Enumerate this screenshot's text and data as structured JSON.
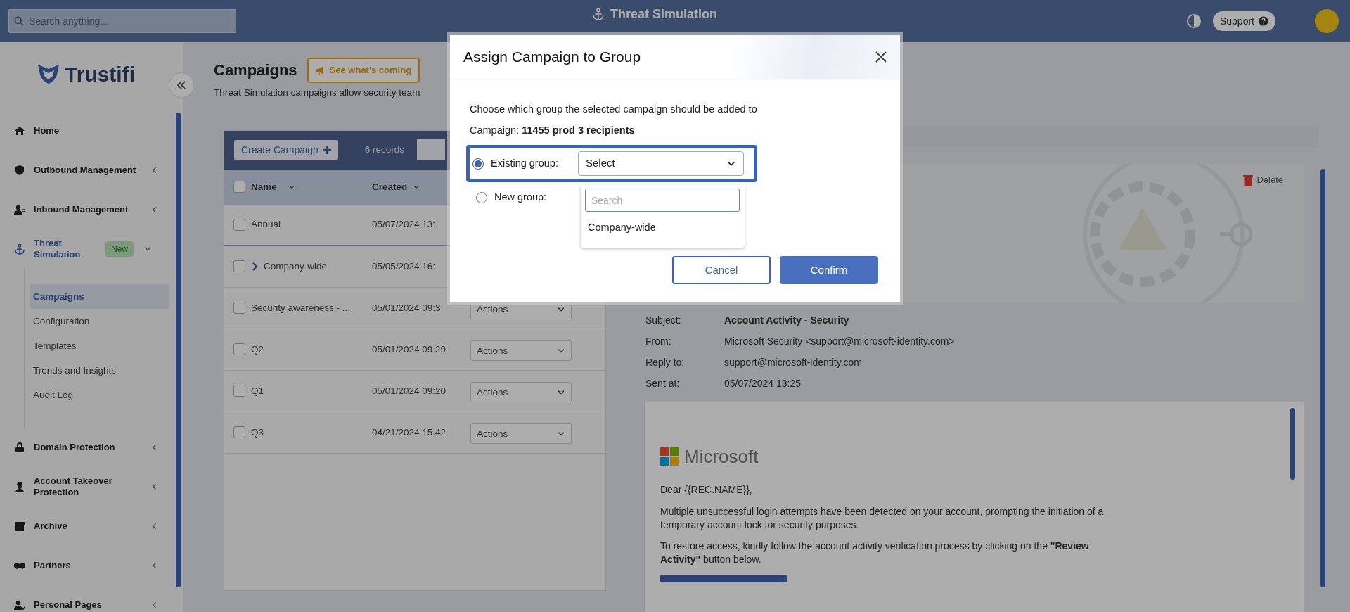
{
  "top_bar": {
    "search": {
      "placeholder": "Search anything..."
    },
    "title": "Threat Simulation",
    "support": "Support"
  },
  "sidebar": {
    "logo": "Trustifi",
    "items": [
      {
        "label": "Home"
      },
      {
        "label": "Outbound Management",
        "expanded": false
      },
      {
        "label": "Inbound Management",
        "expanded": false
      },
      {
        "label": "Threat Simulation",
        "expanded": true,
        "selected": true,
        "badge": "New",
        "children": [
          {
            "label": "Campaigns",
            "selected": true
          },
          {
            "label": "Configuration",
            "selected": false
          },
          {
            "label": "Templates",
            "selected": false
          },
          {
            "label": "Trends and Insights",
            "selected": false
          },
          {
            "label": "Audit Log",
            "selected": false
          }
        ]
      },
      {
        "label": "Domain Protection",
        "expanded": false
      },
      {
        "label": "Account Takeover Protection",
        "expanded": false
      },
      {
        "label": "Archive",
        "expanded": false
      },
      {
        "label": "Partners",
        "expanded": false
      },
      {
        "label": "Personal Pages",
        "expanded": false
      }
    ]
  },
  "page": {
    "title": "Campaigns",
    "whats_coming": "See what's coming",
    "description": "Threat Simulation campaigns allow security team"
  },
  "table": {
    "create_button": "Create Campaign",
    "records": "6 records",
    "select_all": {
      "checked": false
    },
    "columns": [
      "Name",
      "Created"
    ],
    "rows": [
      {
        "checked": false,
        "name": "Annual",
        "created": "05/07/2024 13:"
      },
      {
        "checked": false,
        "name": "Company-wide",
        "created": "05/05/2024 16:",
        "expanded": false
      },
      {
        "checked": false,
        "name": "Security awareness - ...",
        "created": "05/01/2024 09:3",
        "action": "Actions"
      },
      {
        "checked": false,
        "name": "Q2",
        "created": "05/01/2024 09:29",
        "action": "Actions"
      },
      {
        "checked": false,
        "name": "Q1",
        "created": "05/01/2024 09:20",
        "action": "Actions"
      },
      {
        "checked": false,
        "name": "Q3",
        "created": "04/21/2024 15:42",
        "action": "Actions"
      }
    ]
  },
  "details": {
    "delete": "Delete",
    "fields": [
      {
        "label": "Subject:",
        "value": "Account Activity - Security"
      },
      {
        "label": "From:",
        "value": "Microsoft Security <support@microsoft-identity.com>"
      },
      {
        "label": "Reply to:",
        "value": "support@microsoft-identity.com"
      },
      {
        "label": "Sent at:",
        "value": "05/07/2024 13:25"
      }
    ],
    "email": {
      "brand": "Microsoft",
      "greeting": "Dear {{REC.NAME}},",
      "paragraphs": [
        "Multiple unsuccessful login attempts have been detected on your account, prompting the initiation of a temporary account lock for security purposes.",
        "To restore access, kindly follow the account activity verification process by clicking on the **\"Review Activity\"** button below."
      ]
    }
  },
  "dialog": {
    "title": "Assign Campaign to Group",
    "description": "Choose which group the selected campaign should be added to",
    "campaign": "Campaign: **11455 prod 3 recipients**",
    "options": [
      {
        "label": "Existing group:",
        "selected": true
      },
      {
        "label": "New group:",
        "selected": false
      }
    ],
    "select": {
      "value": "Select",
      "open": true,
      "search_placeholder": "Search",
      "options": [
        "Company-wide"
      ]
    },
    "buttons": [
      {
        "label": "Cancel",
        "kind": "secondary"
      },
      {
        "label": "Confirm",
        "kind": "primary"
      }
    ]
  }
}
